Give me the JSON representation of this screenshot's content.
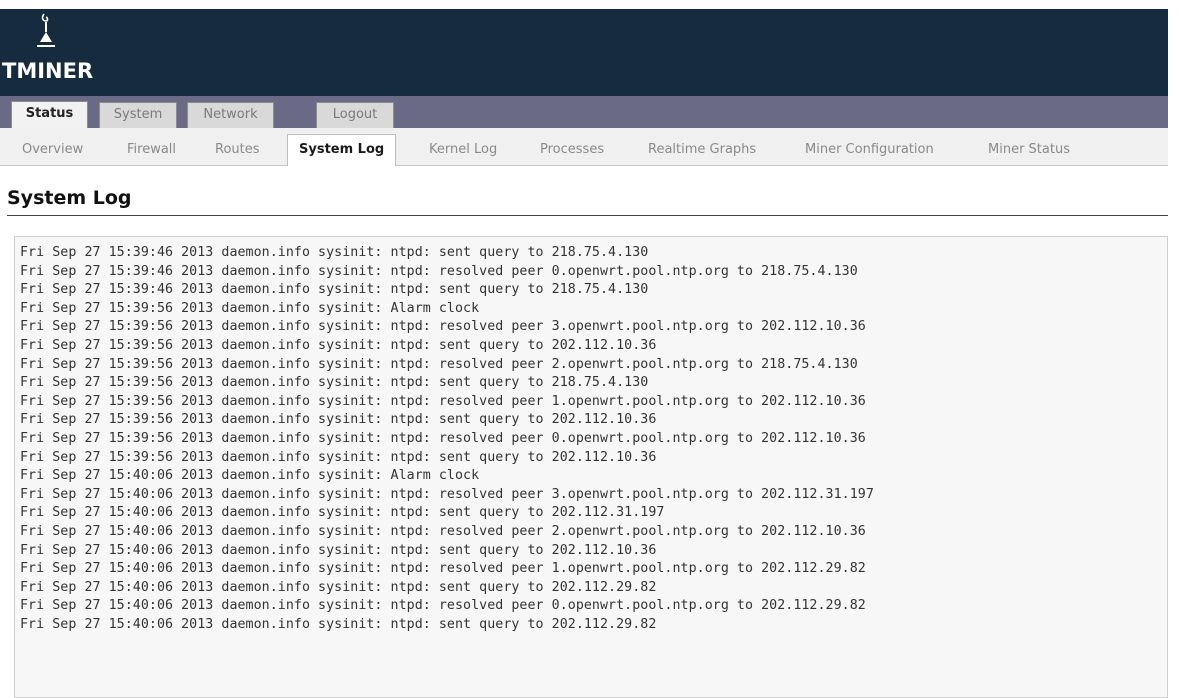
{
  "brand": {
    "name": "TMINER"
  },
  "tabs": [
    {
      "label": "Status",
      "active": true
    },
    {
      "label": "System",
      "active": false
    },
    {
      "label": "Network",
      "active": false
    },
    {
      "label": "Logout",
      "active": false
    }
  ],
  "subnav": [
    {
      "label": "Overview",
      "active": false
    },
    {
      "label": "Firewall",
      "active": false
    },
    {
      "label": "Routes",
      "active": false
    },
    {
      "label": "System Log",
      "active": true
    },
    {
      "label": "Kernel Log",
      "active": false
    },
    {
      "label": "Processes",
      "active": false
    },
    {
      "label": "Realtime Graphs",
      "active": false
    },
    {
      "label": "Miner Configuration",
      "active": false
    },
    {
      "label": "Miner Status",
      "active": false
    }
  ],
  "page": {
    "title": "System Log"
  },
  "log": [
    "Fri Sep 27 15:39:46 2013 daemon.info sysinit: ntpd: sent query to 218.75.4.130",
    "Fri Sep 27 15:39:46 2013 daemon.info sysinit: ntpd: resolved peer 0.openwrt.pool.ntp.org to 218.75.4.130",
    "Fri Sep 27 15:39:46 2013 daemon.info sysinit: ntpd: sent query to 218.75.4.130",
    "Fri Sep 27 15:39:56 2013 daemon.info sysinit: Alarm clock",
    "Fri Sep 27 15:39:56 2013 daemon.info sysinit: ntpd: resolved peer 3.openwrt.pool.ntp.org to 202.112.10.36",
    "Fri Sep 27 15:39:56 2013 daemon.info sysinit: ntpd: sent query to 202.112.10.36",
    "Fri Sep 27 15:39:56 2013 daemon.info sysinit: ntpd: resolved peer 2.openwrt.pool.ntp.org to 218.75.4.130",
    "Fri Sep 27 15:39:56 2013 daemon.info sysinit: ntpd: sent query to 218.75.4.130",
    "Fri Sep 27 15:39:56 2013 daemon.info sysinit: ntpd: resolved peer 1.openwrt.pool.ntp.org to 202.112.10.36",
    "Fri Sep 27 15:39:56 2013 daemon.info sysinit: ntpd: sent query to 202.112.10.36",
    "Fri Sep 27 15:39:56 2013 daemon.info sysinit: ntpd: resolved peer 0.openwrt.pool.ntp.org to 202.112.10.36",
    "Fri Sep 27 15:39:56 2013 daemon.info sysinit: ntpd: sent query to 202.112.10.36",
    "Fri Sep 27 15:40:06 2013 daemon.info sysinit: Alarm clock",
    "Fri Sep 27 15:40:06 2013 daemon.info sysinit: ntpd: resolved peer 3.openwrt.pool.ntp.org to 202.112.31.197",
    "Fri Sep 27 15:40:06 2013 daemon.info sysinit: ntpd: sent query to 202.112.31.197",
    "Fri Sep 27 15:40:06 2013 daemon.info sysinit: ntpd: resolved peer 2.openwrt.pool.ntp.org to 202.112.10.36",
    "Fri Sep 27 15:40:06 2013 daemon.info sysinit: ntpd: sent query to 202.112.10.36",
    "Fri Sep 27 15:40:06 2013 daemon.info sysinit: ntpd: resolved peer 1.openwrt.pool.ntp.org to 202.112.29.82",
    "Fri Sep 27 15:40:06 2013 daemon.info sysinit: ntpd: sent query to 202.112.29.82",
    "Fri Sep 27 15:40:06 2013 daemon.info sysinit: ntpd: resolved peer 0.openwrt.pool.ntp.org to 202.112.29.82",
    "Fri Sep 27 15:40:06 2013 daemon.info sysinit: ntpd: sent query to 202.112.29.82"
  ]
}
